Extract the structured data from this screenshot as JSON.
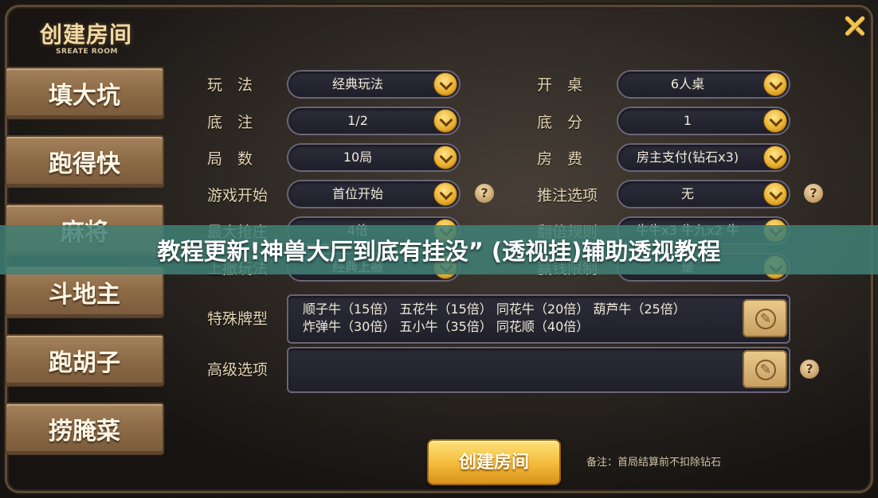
{
  "header": {
    "title": "创建房间",
    "subtitle": "SREATE ROOM"
  },
  "sidebar": {
    "items": [
      {
        "label": "填大坑"
      },
      {
        "label": "跑得快"
      },
      {
        "label": "麻将"
      },
      {
        "label": "斗地主"
      },
      {
        "label": "跑胡子"
      },
      {
        "label": "捞腌菜"
      }
    ]
  },
  "settings": {
    "left": [
      {
        "label": "玩　法",
        "value": "经典玩法"
      },
      {
        "label": "底　注",
        "value": "1/2"
      },
      {
        "label": "局　数",
        "value": "10局"
      },
      {
        "label": "游戏开始",
        "value": "首位开始"
      },
      {
        "label": "最大抢庄",
        "value": "4倍"
      },
      {
        "label": "上撤玩法",
        "value": "经典上撤"
      }
    ],
    "right": [
      {
        "label": "开　桌",
        "value": "6人桌"
      },
      {
        "label": "底　分",
        "value": "1"
      },
      {
        "label": "房　费",
        "value": "房主支付(钻石x3)"
      },
      {
        "label": "推注选项",
        "value": "无"
      },
      {
        "label": "翻倍规则",
        "value": "牛牛x3 牛九x2 牛"
      },
      {
        "label": "赢钱限制",
        "value": "是"
      }
    ]
  },
  "special": {
    "label": "特殊牌型",
    "line1": "顺子牛（15倍） 五花牛（15倍） 同花牛（20倍） 葫芦牛（25倍）",
    "line2": "炸弹牛（30倍） 五小牛（35倍） 同花顺（40倍）"
  },
  "advanced": {
    "label": "高级选项",
    "value": ""
  },
  "footer": {
    "create_label": "创建房间",
    "note": "备注：首局结算前不扣除钻石"
  },
  "banner": {
    "text": "教程更新!神兽大厅到底有挂没” (透视挂)辅助透视教程"
  },
  "icons": {
    "help": "?",
    "edit": "✎"
  },
  "colors": {
    "accent_gold": "#f3b93a",
    "banner_teal": "#408076",
    "tab_wood": "#8e6c48"
  }
}
